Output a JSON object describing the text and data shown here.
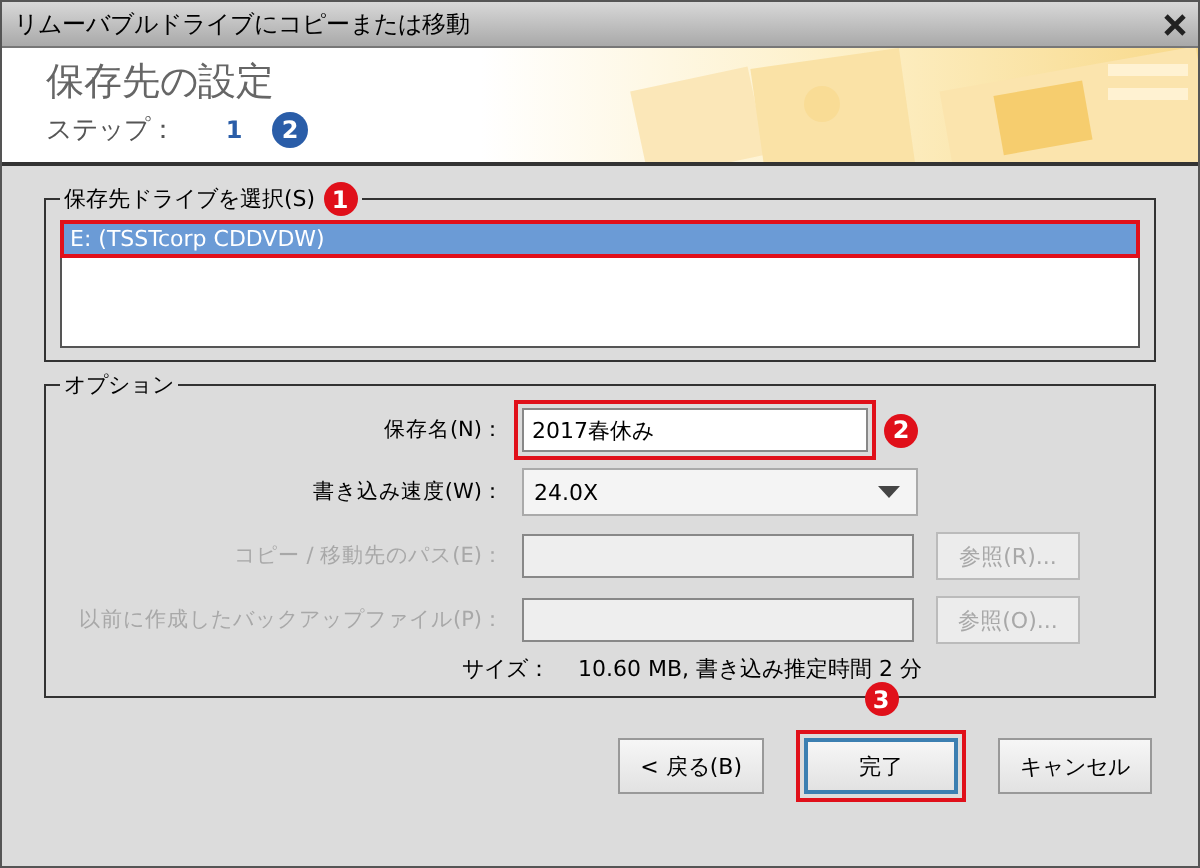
{
  "window": {
    "title": "リムーバブルドライブにコピーまたは移動"
  },
  "header": {
    "heading": "保存先の設定",
    "step_label": "ステップ：",
    "steps": [
      {
        "label": "1",
        "selected": false
      },
      {
        "label": "2",
        "selected": true
      }
    ]
  },
  "drive_group": {
    "legend": "保存先ドライブを選択(S)",
    "callout": "1",
    "items": [
      {
        "label": "E: (TSSTcorp CDDVDW)",
        "selected": true
      }
    ]
  },
  "options": {
    "legend": "オプション",
    "rows": [
      {
        "kind": "text",
        "label": "保存名(N)：",
        "value": "2017春休み",
        "disabled": false,
        "callout": "2"
      },
      {
        "kind": "select",
        "label": "書き込み速度(W)：",
        "value": "24.0X",
        "disabled": false
      },
      {
        "kind": "path",
        "label": "コピー / 移動先のパス(E)：",
        "disabled": true,
        "button": "参照(R)..."
      },
      {
        "kind": "path",
        "label": "以前に作成したバックアップファイル(P)：",
        "disabled": true,
        "button": "参照(O)..."
      }
    ],
    "size_label": "サイズ：",
    "size_value": "10.60 MB, 書き込み推定時間 2 分"
  },
  "buttons": [
    {
      "label": "< 戻る(B)",
      "default": false
    },
    {
      "label": "完了",
      "default": true,
      "callout": "3"
    },
    {
      "label": "キャンセル",
      "default": false
    }
  ]
}
